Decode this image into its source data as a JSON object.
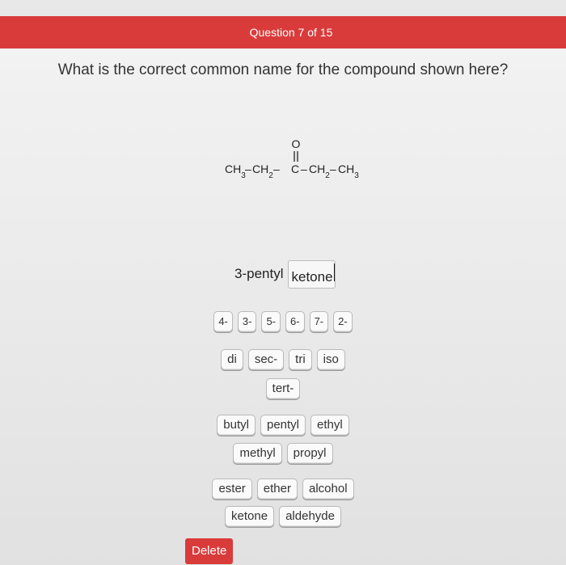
{
  "header": {
    "progress_text": "Question 7 of 15"
  },
  "question": {
    "text": "What is the correct common name for the compound shown here?"
  },
  "structure": {
    "oxygen": "O",
    "chain": [
      "CH3",
      "CH2",
      "C",
      "CH2",
      "CH3"
    ]
  },
  "answer": {
    "tokens": [
      "3-pentyl",
      "ketone"
    ]
  },
  "tiles": {
    "numbers": [
      "4-",
      "3-",
      "5-",
      "6-",
      "7-",
      "2-"
    ],
    "prefixes_row1": [
      "di",
      "sec-",
      "tri",
      "iso"
    ],
    "prefixes_row2": [
      "tert-"
    ],
    "groups_row1": [
      "butyl",
      "pentyl",
      "ethyl"
    ],
    "groups_row2": [
      "methyl",
      "propyl"
    ],
    "classes_row1": [
      "ester",
      "ether",
      "alcohol"
    ],
    "classes_row2": [
      "ketone",
      "aldehyde"
    ]
  },
  "actions": {
    "delete_label": "Delete"
  },
  "colors": {
    "accent": "#d93b3b"
  }
}
